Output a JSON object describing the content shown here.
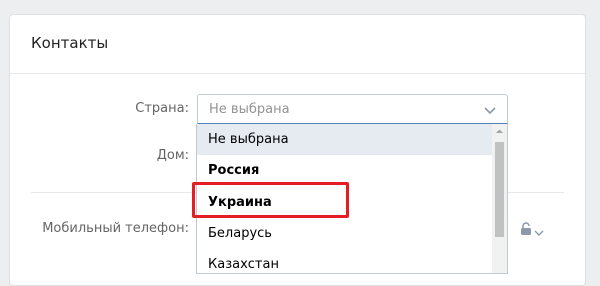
{
  "card": {
    "title": "Контакты"
  },
  "form": {
    "country_label": "Страна:",
    "country_value": "Не выбрана",
    "city_label": "Дом:",
    "phone_label": "Мобильный телефон:"
  },
  "dropdown": {
    "items": [
      {
        "label": "Не выбрана"
      },
      {
        "label": "Россия"
      },
      {
        "label": "Украина"
      },
      {
        "label": "Беларусь"
      },
      {
        "label": "Казахстан"
      }
    ]
  },
  "icons": {
    "select_chevron": "chevron-down-icon",
    "privacy_lock": "lock-icon",
    "privacy_chevron": "chevron-down-icon",
    "scroll_up": "arrow-up-icon"
  },
  "colors": {
    "accent": "#5181b8",
    "highlight": "#e31e24",
    "hover": "#e5ebf1"
  }
}
